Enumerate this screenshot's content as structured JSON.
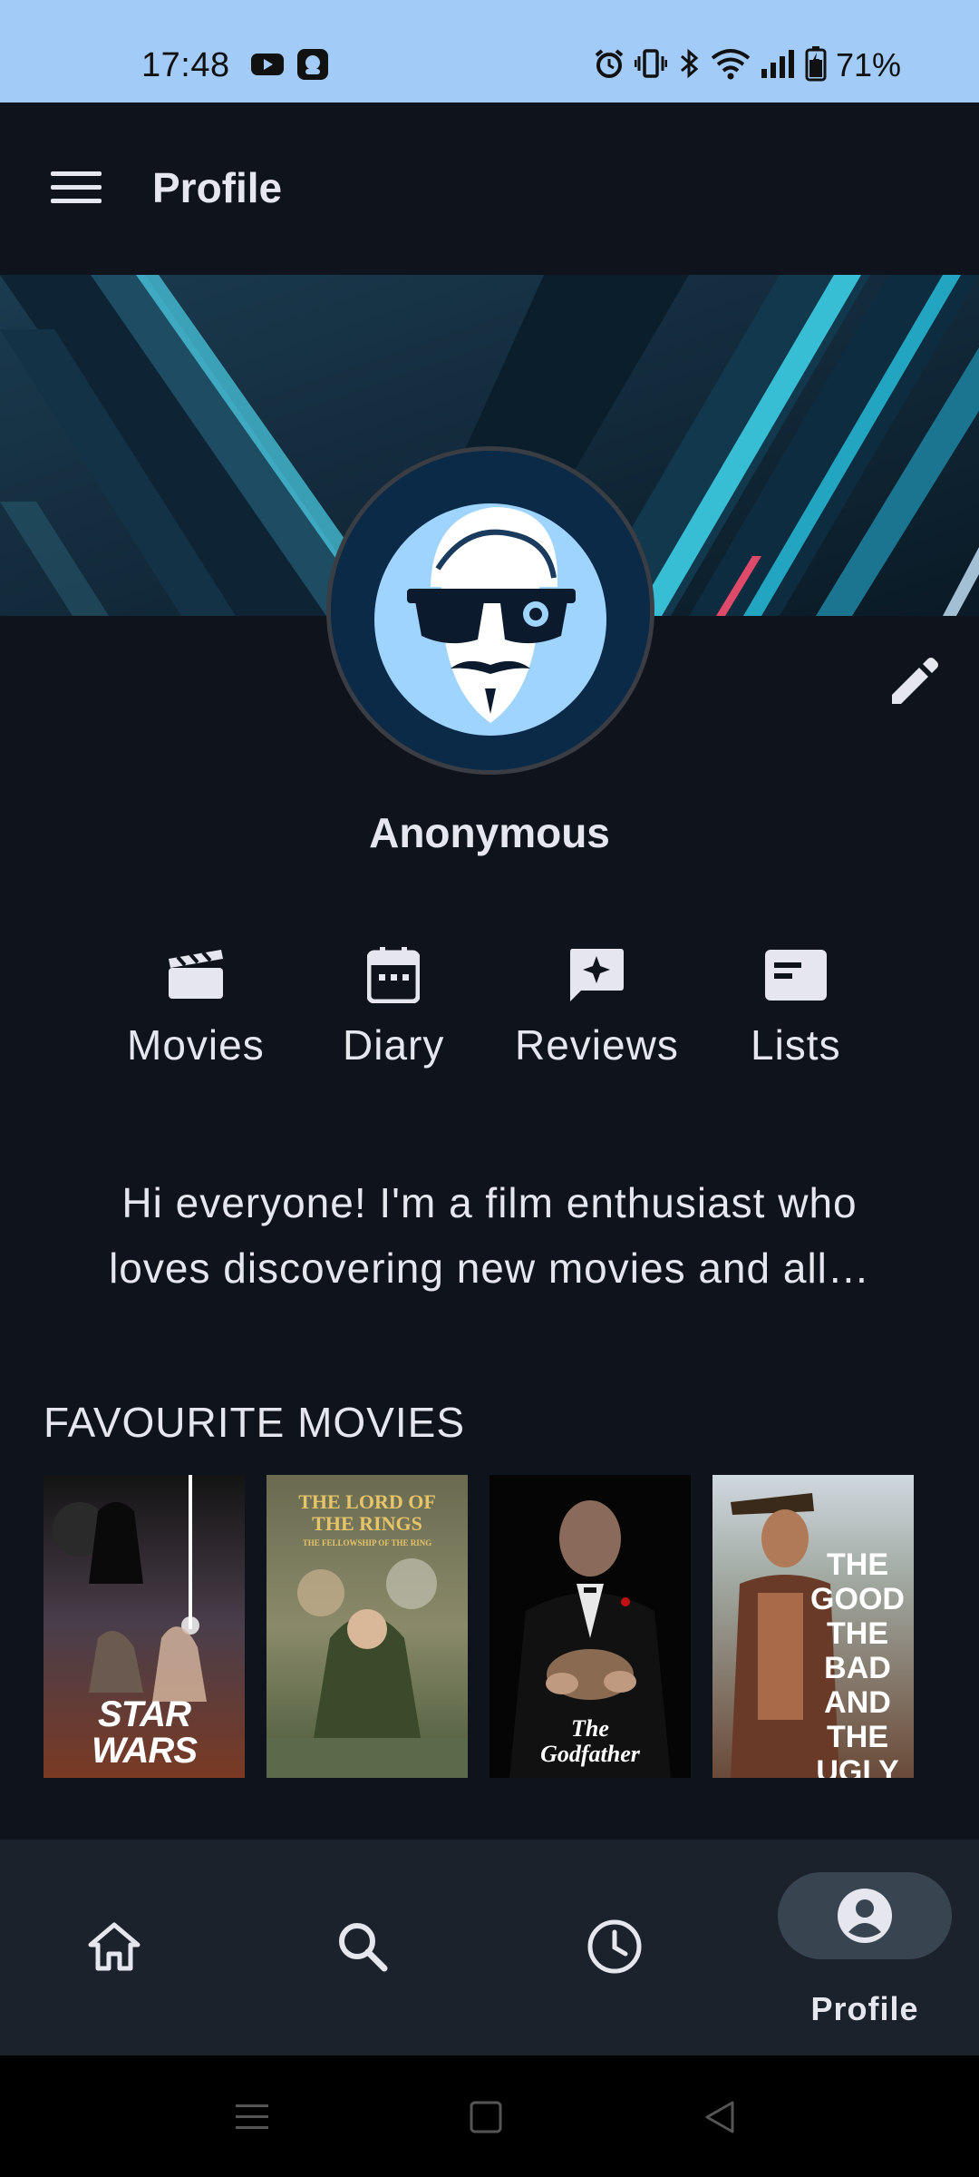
{
  "status_bar": {
    "time": "17:48",
    "battery": "71%",
    "icons": [
      "youtube-icon",
      "app-notification-icon",
      "alarm-icon",
      "vibrate-icon",
      "bluetooth-icon",
      "wifi-icon",
      "signal-icon",
      "battery-icon"
    ]
  },
  "app_bar": {
    "title": "Profile",
    "menu_icon": "hamburger-menu-icon"
  },
  "profile": {
    "username": "Anonymous",
    "edit_icon": "pencil-icon",
    "bio": "Hi everyone! I'm a film enthusiast who loves discovering new movies and all…"
  },
  "stats": [
    {
      "label": "Movies",
      "icon": "clapperboard-icon"
    },
    {
      "label": "Diary",
      "icon": "calendar-icon"
    },
    {
      "label": "Reviews",
      "icon": "review-icon"
    },
    {
      "label": "Lists",
      "icon": "list-card-icon"
    }
  ],
  "favourites": {
    "title": "FAVOURITE MOVIES",
    "posters": [
      {
        "text": "STAR WARS",
        "bg": "#3a2a20"
      },
      {
        "text": "THE LORD OF THE RINGS",
        "sub": "THE FELLOWSHIP OF THE RING",
        "bg": "#5a5a3c"
      },
      {
        "text": "The Godfather",
        "bg": "#050505"
      },
      {
        "text": "THE GOOD THE BAD AND THE UGLY",
        "bg": "#6b4a38"
      }
    ]
  },
  "bottom_nav": {
    "items": [
      {
        "icon": "home-icon",
        "label": ""
      },
      {
        "icon": "search-icon",
        "label": ""
      },
      {
        "icon": "history-clock-icon",
        "label": ""
      },
      {
        "icon": "profile-icon",
        "label": "Profile",
        "active": true
      }
    ]
  },
  "colors": {
    "status_bar": "#a3cbf7",
    "background": "#0f131b",
    "bottom_nav": "#1c222c",
    "active_pill": "#394451",
    "text": "#e6e6ee"
  }
}
